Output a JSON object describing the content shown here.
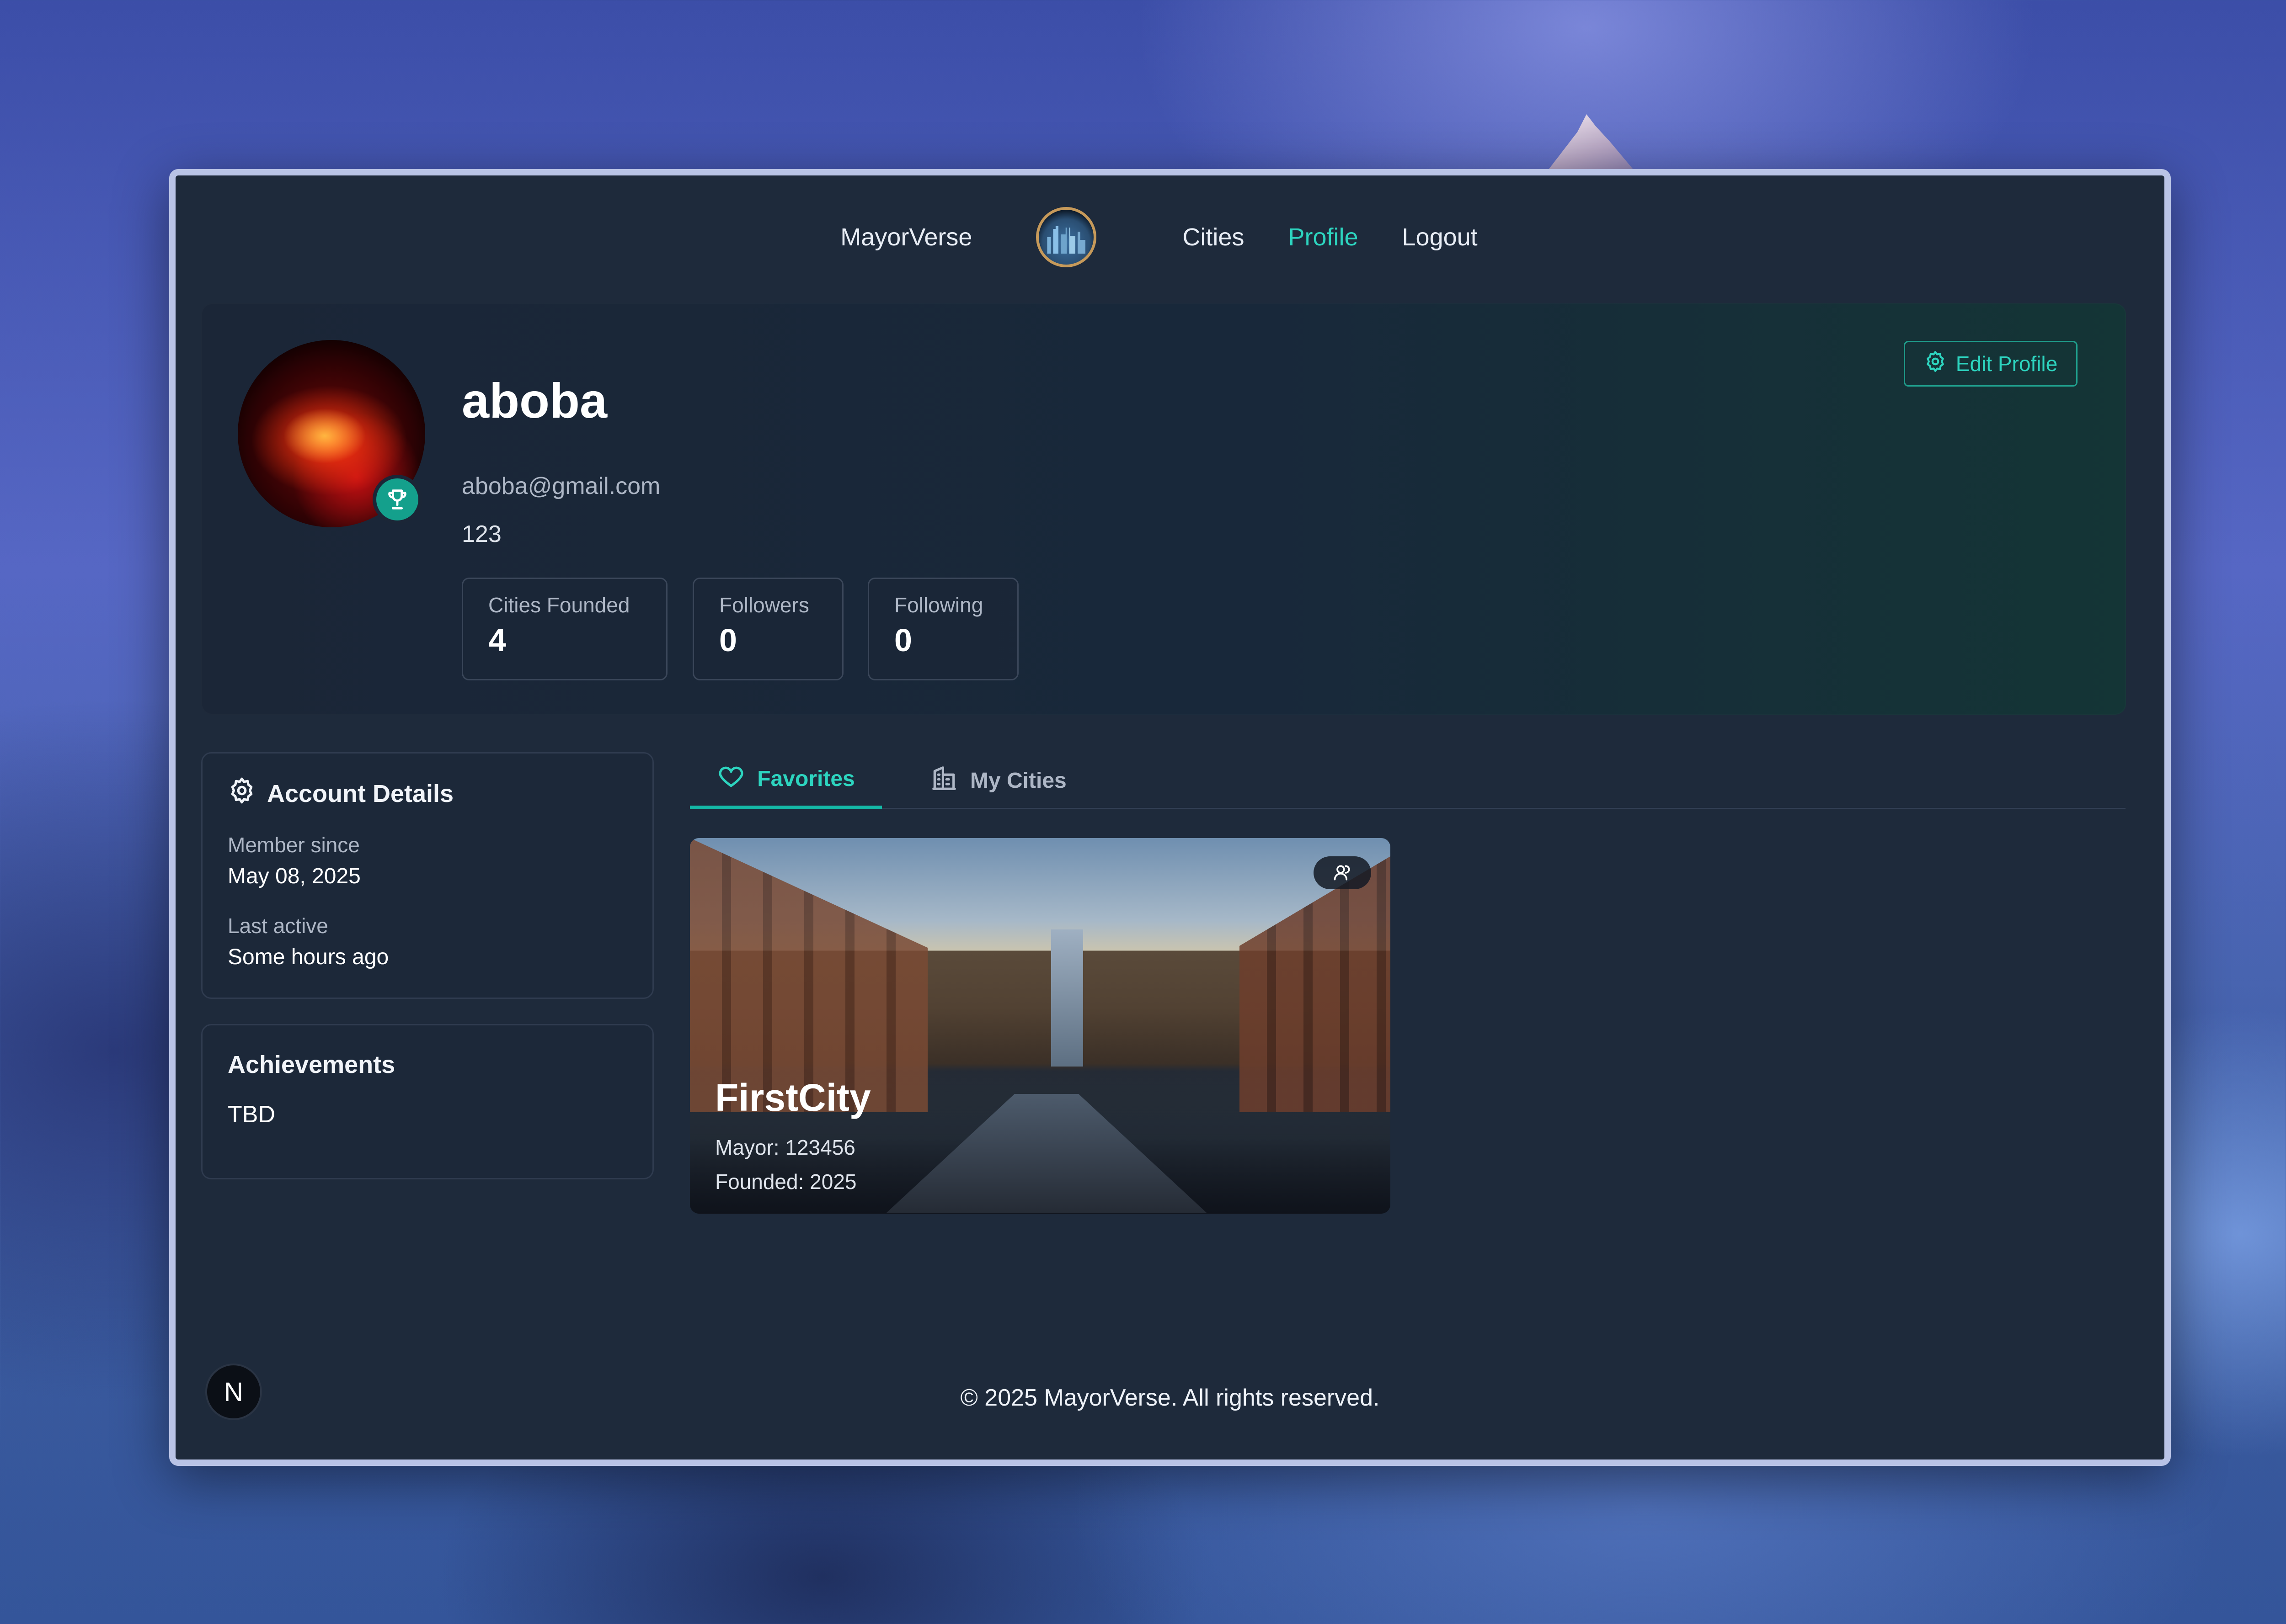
{
  "nav": {
    "brand": "MayorVerse",
    "links": [
      "Cities",
      "Profile",
      "Logout"
    ],
    "active": "Profile",
    "logo_icon": "city-logo-icon"
  },
  "profile": {
    "username": "aboba",
    "email": "aboba@gmail.com",
    "bio": "123",
    "badge_icon": "trophy-icon",
    "edit_label": "Edit Profile",
    "stats": [
      {
        "label": "Cities Founded",
        "value": "4"
      },
      {
        "label": "Followers",
        "value": "0"
      },
      {
        "label": "Following",
        "value": "0"
      }
    ]
  },
  "account": {
    "title": "Account Details",
    "member_since_label": "Member since",
    "member_since_value": "May 08, 2025",
    "last_active_label": "Last active",
    "last_active_value": "Some hours ago"
  },
  "achievements": {
    "title": "Achievements",
    "text": "TBD"
  },
  "tabs": [
    {
      "label": "Favorites",
      "icon": "heart-icon",
      "active": true
    },
    {
      "label": "My Cities",
      "icon": "building-icon",
      "active": false
    }
  ],
  "city_card": {
    "name": "FirstCity",
    "mayor": "Mayor: 123456",
    "founded": "Founded: 2025",
    "badge_icon": "users-icon"
  },
  "footer": {
    "copyright": "© 2025 MayorVerse. All rights reserved.",
    "dev_badge": "N"
  },
  "colors": {
    "accent": "#2dd4bf",
    "window_bg": "#1e2a3b",
    "card_bg": "#1c2839"
  }
}
